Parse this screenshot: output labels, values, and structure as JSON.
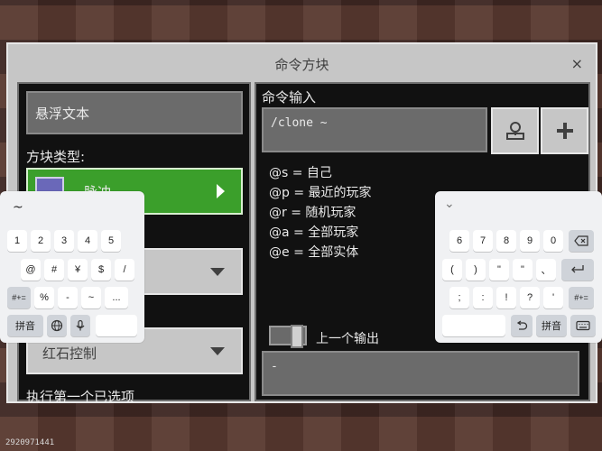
{
  "dialog": {
    "title": "命令方块",
    "close_symbol": "×"
  },
  "left": {
    "hover_text": "悬浮文本",
    "block_type_label": "方块类型:",
    "block_type_value": "脉冲",
    "redstone_value": "红石控制",
    "exec_first_label": "执行第一个已选项"
  },
  "right": {
    "command_input_label": "命令输入",
    "command_value": "/clone ~",
    "selectors": [
      "@s = 自己",
      "@p = 最近的玩家",
      "@r = 随机玩家",
      "@a = 全部玩家",
      "@e = 全部实体"
    ],
    "prev_output_label": "上一个输出",
    "output_value": "-"
  },
  "kb_left": {
    "tilde": "~",
    "row1": [
      "1",
      "2",
      "3",
      "4",
      "5"
    ],
    "row2": [
      "@",
      "#",
      "¥",
      "$",
      "/"
    ],
    "row3": [
      "#+=",
      "%",
      "-",
      "~",
      "..."
    ],
    "row4": [
      "拼音",
      "globe-icon",
      "mic-icon",
      ""
    ]
  },
  "kb_right": {
    "chevron": "⌄",
    "row1": [
      "6",
      "7",
      "8",
      "9",
      "0",
      "backspace-icon"
    ],
    "row2": [
      "(",
      ")",
      "\"",
      "\"",
      "、",
      "return-icon"
    ],
    "row3": [
      ";",
      ":",
      "!",
      "?",
      "'",
      "#+="
    ],
    "row4": [
      "",
      "undo-icon",
      "拼音",
      "keyboard-icon"
    ]
  },
  "watermark": "2920971441"
}
